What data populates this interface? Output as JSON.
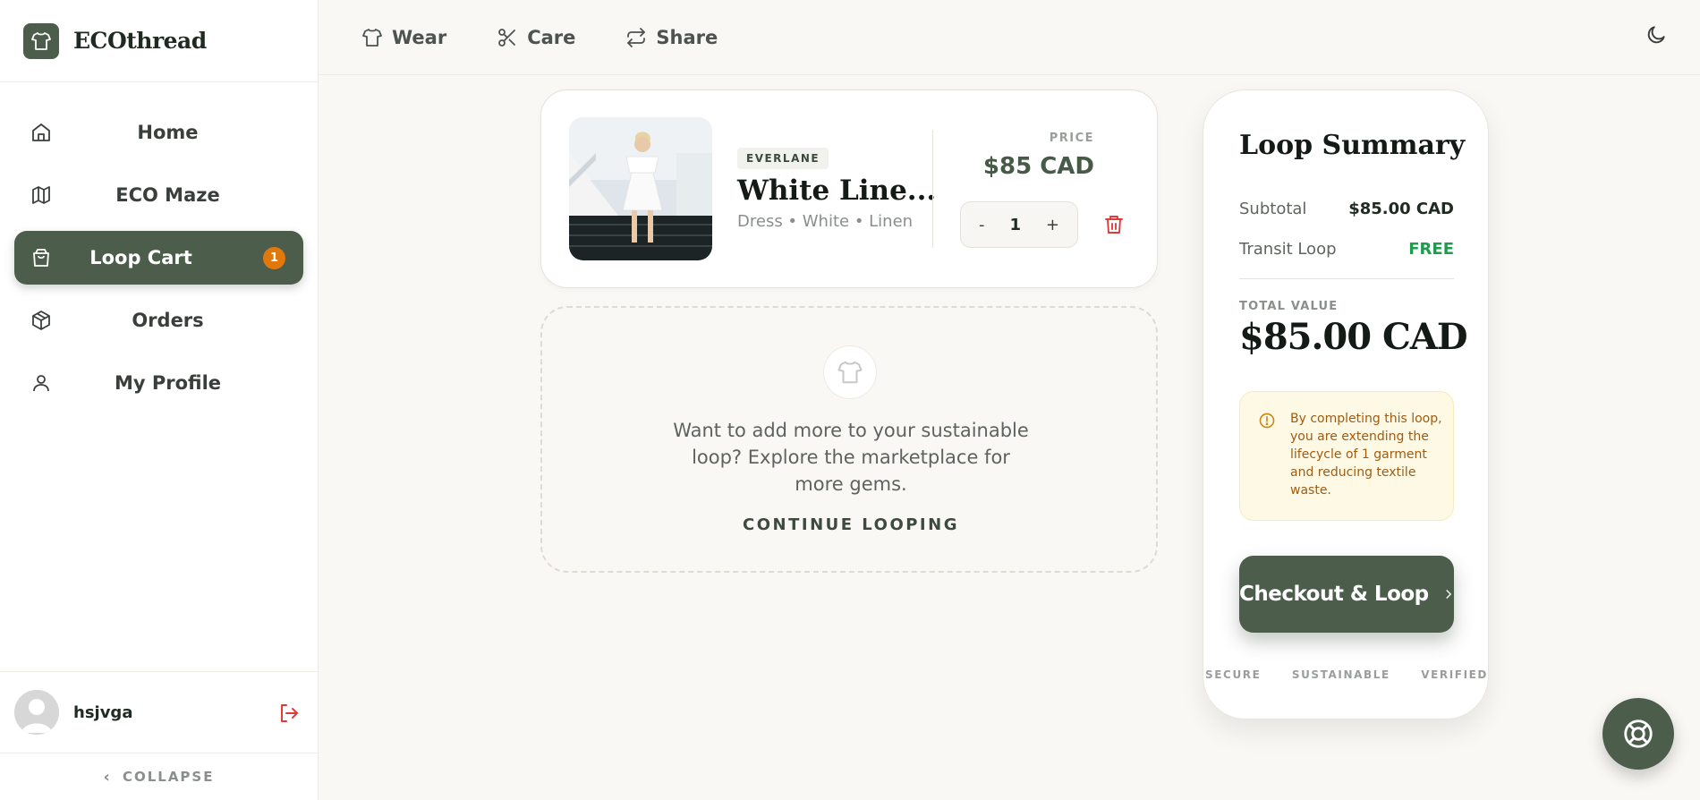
{
  "app": {
    "brand": "ECOthread"
  },
  "sidebar": {
    "items": [
      {
        "label": "Home",
        "icon": "home-icon"
      },
      {
        "label": "ECO Maze",
        "icon": "map-icon"
      },
      {
        "label": "Loop Cart",
        "icon": "shopping-bag-icon",
        "active": true,
        "badge": "1"
      },
      {
        "label": "Orders",
        "icon": "package-icon"
      },
      {
        "label": "My Profile",
        "icon": "user-icon"
      }
    ],
    "user": {
      "name": "hsjvga"
    },
    "collapse_label": "COLLAPSE"
  },
  "topnav": {
    "items": [
      {
        "label": "Wear",
        "icon": "shirt-icon"
      },
      {
        "label": "Care",
        "icon": "scissors-icon"
      },
      {
        "label": "Share",
        "icon": "repeat-icon"
      }
    ]
  },
  "cart": {
    "item": {
      "brand": "EVERLANE",
      "title": "White Line...",
      "meta": "Dress • White • Linen",
      "price_label": "PRICE",
      "price": "$85 CAD",
      "quantity": "1",
      "decrement": "-",
      "increment": "+"
    },
    "continue": {
      "text": "Want to add more to your sustainable loop? Explore the marketplace for more gems.",
      "link": "CONTINUE LOOPING"
    }
  },
  "summary": {
    "title": "Loop Summary",
    "subtotal_label": "Subtotal",
    "subtotal_value": "$85.00 CAD",
    "transit_label": "Transit Loop",
    "transit_value": "FREE",
    "total_label": "TOTAL VALUE",
    "total_value": "$85.00 CAD",
    "notice": "By completing this loop, you are extending the lifecycle of 1 garment and reducing textile waste.",
    "checkout_label": "Checkout & Loop",
    "trust": [
      "SECURE",
      "SUSTAINABLE",
      "VERIFIED"
    ]
  },
  "colors": {
    "accent": "#4c5d4c",
    "badge": "#e1780c",
    "free": "#1e9c4b",
    "danger": "#e03b3b",
    "notice_bg": "#fef9e4",
    "notice_text": "#a05b12"
  }
}
